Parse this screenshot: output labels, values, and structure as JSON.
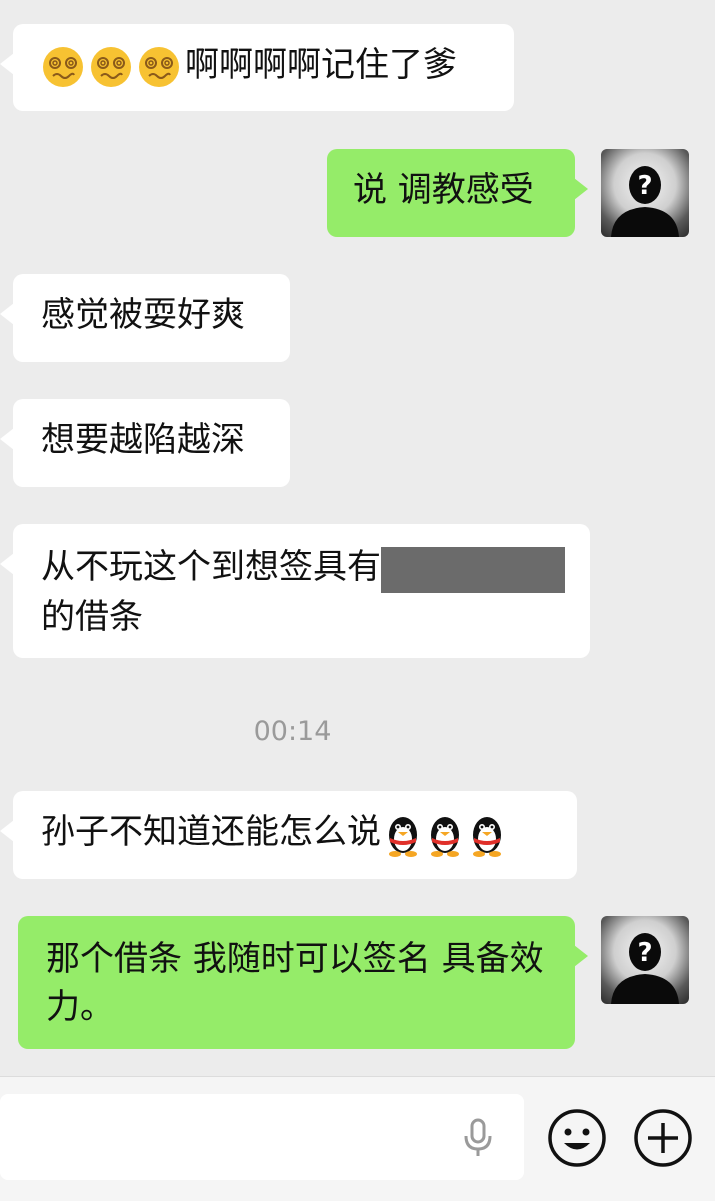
{
  "messages": [
    {
      "side": "left",
      "emoji": [
        "dizzy-face-emoji",
        "dizzy-face-emoji",
        "dizzy-face-emoji"
      ],
      "text": "啊啊啊啊记住了爹"
    },
    {
      "side": "right",
      "text": "说 调教感受"
    },
    {
      "side": "left",
      "text": "感觉被耍好爽"
    },
    {
      "side": "left",
      "text": "想要越陷越深"
    },
    {
      "side": "left",
      "text_before": "从不玩这个到想签具有",
      "text_after": "的借条",
      "redacted": true
    },
    {
      "side": "left",
      "text": "孙子不知道还能怎么说",
      "emoji": [
        "qq-penguin-emoji",
        "qq-penguin-emoji",
        "qq-penguin-emoji"
      ]
    },
    {
      "side": "right",
      "text": "那个借条 我随时可以签名 具备效力。"
    }
  ],
  "timestamp": "00:14",
  "colors": {
    "background": "#ececec",
    "incoming_bubble": "#ffffff",
    "outgoing_bubble": "#95ec69",
    "timestamp_text": "#9a9a9a"
  },
  "icons": {
    "voice": "microphone-icon",
    "emoji": "smiley-icon",
    "more": "plus-circle-icon",
    "avatar": "question-silhouette-avatar"
  }
}
